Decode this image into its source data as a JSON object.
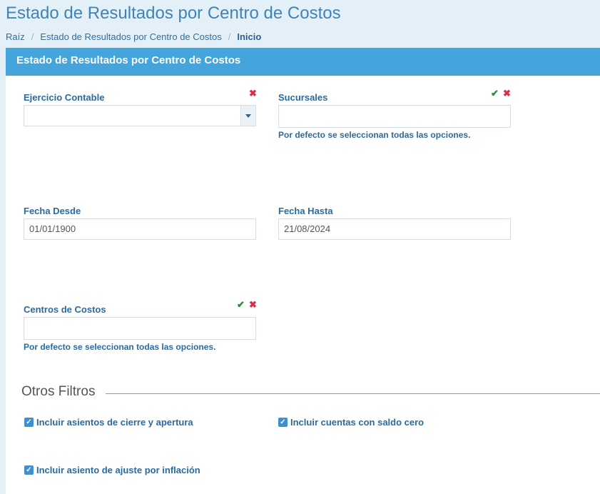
{
  "page": {
    "title": "Estado de Resultados por Centro de Costos",
    "breadcrumb": [
      "Raíz",
      "Estado de Resultados por Centro de Costos",
      "Inicio"
    ]
  },
  "panel": {
    "title": "Estado de Resultados por Centro de Costos"
  },
  "form": {
    "ejercicio": {
      "label": "Ejercicio Contable",
      "value": ""
    },
    "sucursales": {
      "label": "Sucursales",
      "value": "",
      "help": "Por defecto se seleccionan todas las opciones."
    },
    "fecha_desde": {
      "label": "Fecha Desde",
      "value": "01/01/1900"
    },
    "fecha_hasta": {
      "label": "Fecha Hasta",
      "value": "21/08/2024"
    },
    "centros": {
      "label": "Centros de Costos",
      "value": "",
      "help": "Por defecto se seleccionan todas las opciones."
    }
  },
  "otros_filtros": {
    "title": "Otros Filtros",
    "options": [
      {
        "label": "Incluir asientos de cierre y apertura",
        "checked": true
      },
      {
        "label": "Incluir cuentas con saldo cero",
        "checked": true
      },
      {
        "label": "Incluir asiento de ajuste por inflación",
        "checked": true
      }
    ]
  },
  "icons": {
    "check": "✔",
    "clear": "✖",
    "checkbox_tick": "✓"
  },
  "colors": {
    "header": "#44a5dc",
    "accent": "#2a6a9e",
    "clear": "#d32f4e",
    "check": "#2a8a3a"
  }
}
